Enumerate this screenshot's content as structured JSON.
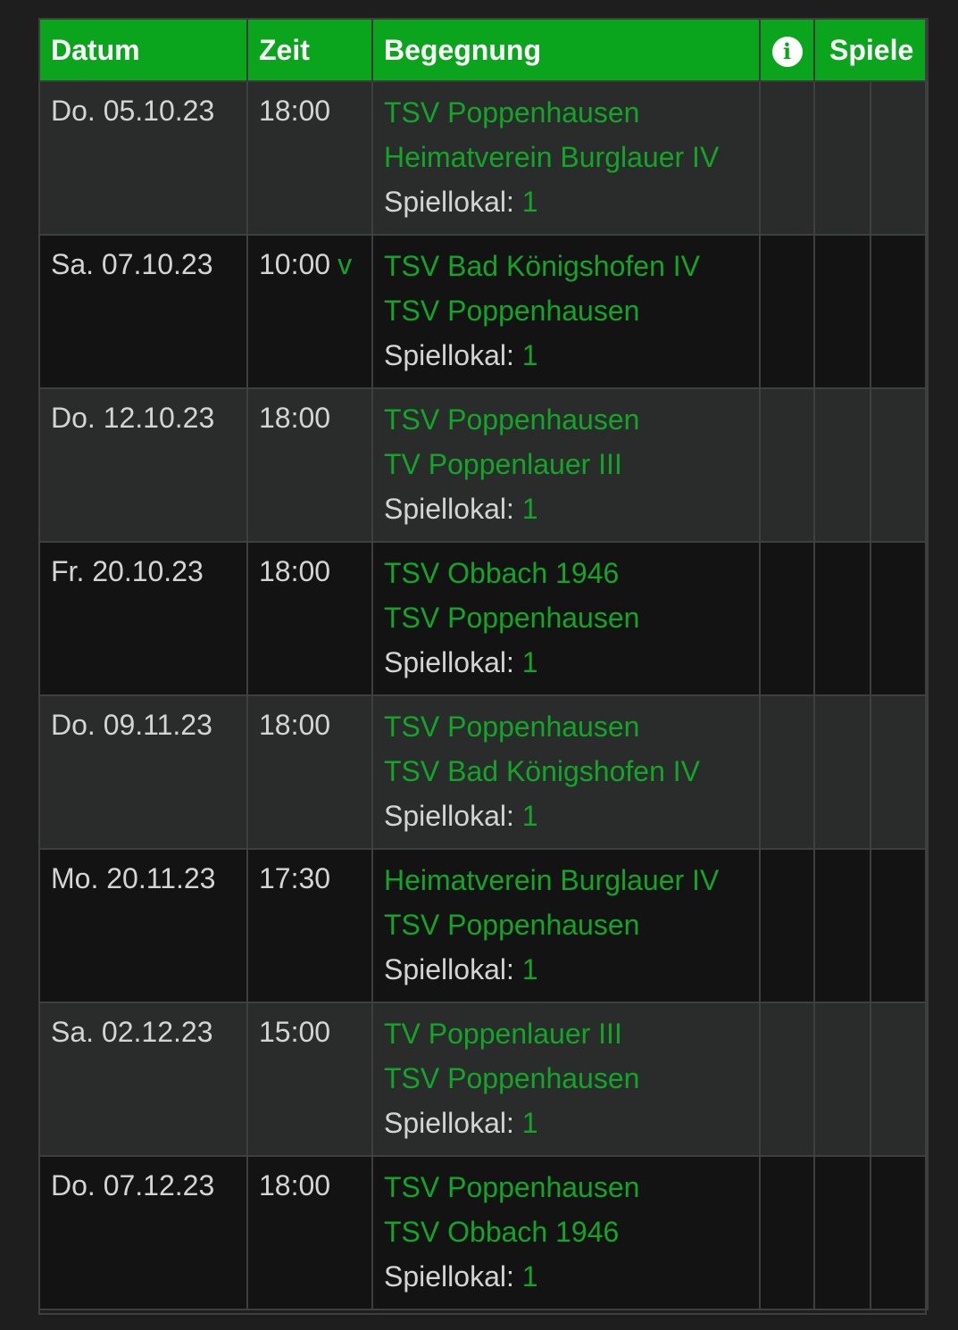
{
  "header": {
    "datum": "Datum",
    "zeit": "Zeit",
    "begegnung": "Begegnung",
    "info_icon": "info-icon",
    "spiele": "Spiele"
  },
  "venue_label": "Spiellokal:",
  "colors": {
    "header_bg": "#0aa51c",
    "link_green": "#13a527",
    "row_odd": "#2a2c2b",
    "row_even": "#131313"
  },
  "rows": [
    {
      "date": "Do. 05.10.23",
      "time": "18:00",
      "flag": "",
      "home": "TSV Poppenhausen",
      "away": "Heimatverein Burglauer IV",
      "venue": "1"
    },
    {
      "date": "Sa. 07.10.23",
      "time": "10:00",
      "flag": "v",
      "home": "TSV Bad Königshofen IV",
      "away": "TSV Poppenhausen",
      "venue": "1"
    },
    {
      "date": "Do. 12.10.23",
      "time": "18:00",
      "flag": "",
      "home": "TSV Poppenhausen",
      "away": "TV Poppenlauer III",
      "venue": "1"
    },
    {
      "date": "Fr. 20.10.23",
      "time": "18:00",
      "flag": "",
      "home": "TSV Obbach 1946",
      "away": "TSV Poppenhausen",
      "venue": "1"
    },
    {
      "date": "Do. 09.11.23",
      "time": "18:00",
      "flag": "",
      "home": "TSV Poppenhausen",
      "away": "TSV Bad Königshofen IV",
      "venue": "1"
    },
    {
      "date": "Mo. 20.11.23",
      "time": "17:30",
      "flag": "",
      "home": "Heimatverein Burglauer IV",
      "away": "TSV Poppenhausen",
      "venue": "1"
    },
    {
      "date": "Sa. 02.12.23",
      "time": "15:00",
      "flag": "",
      "home": "TV Poppenlauer III",
      "away": "TSV Poppenhausen",
      "venue": "1"
    },
    {
      "date": "Do. 07.12.23",
      "time": "18:00",
      "flag": "",
      "home": "TSV Poppenhausen",
      "away": "TSV Obbach 1946",
      "venue": "1"
    }
  ]
}
